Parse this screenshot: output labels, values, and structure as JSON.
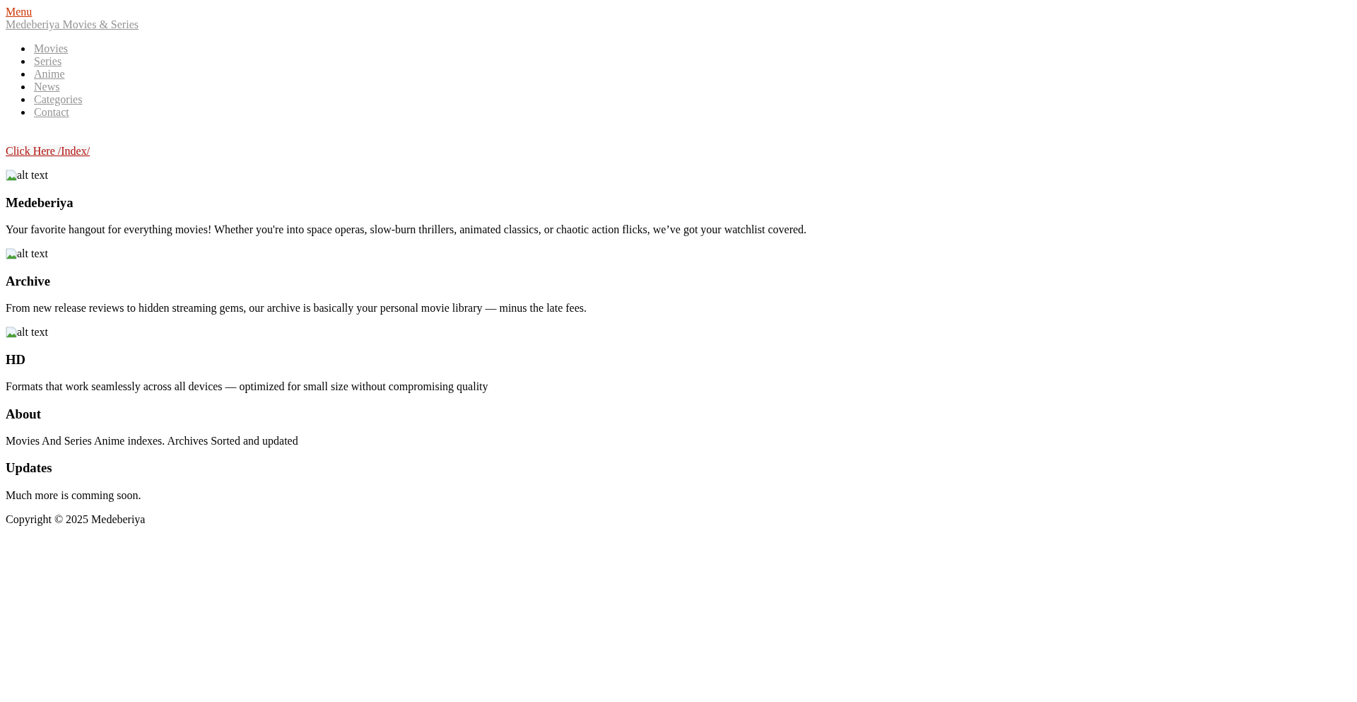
{
  "header": {
    "menu_link": "Menu",
    "brand_link": "Medeberiya Movies & Series",
    "nav": [
      {
        "label": "Movies"
      },
      {
        "label": "Series"
      },
      {
        "label": "Anime"
      },
      {
        "label": "News"
      },
      {
        "label": "Categories"
      },
      {
        "label": "Contact"
      }
    ],
    "index_link": "Click Here /Index/"
  },
  "features": [
    {
      "image_alt": "alt text",
      "title": "Medeberiya",
      "text": "Your favorite hangout for everything movies! Whether you're into space operas, slow-burn thrillers, animated classics, or chaotic action flicks, we’ve got your watchlist covered."
    },
    {
      "image_alt": "alt text",
      "title": "Archive",
      "text": "From new release reviews to hidden streaming gems, our archive is basically your personal movie library — minus the late fees."
    },
    {
      "image_alt": "alt text",
      "title": "HD",
      "text": "Formats that work seamlessly across all devices — optimized for small size without compromising quality"
    }
  ],
  "sections": [
    {
      "title": "About",
      "text": "Movies And Series Anime indexes. Archives Sorted and updated"
    },
    {
      "title": "Updates",
      "text": "Much more is comming soon."
    }
  ],
  "footer": {
    "copyright": "Copyright © 2025 Medeberiya"
  }
}
